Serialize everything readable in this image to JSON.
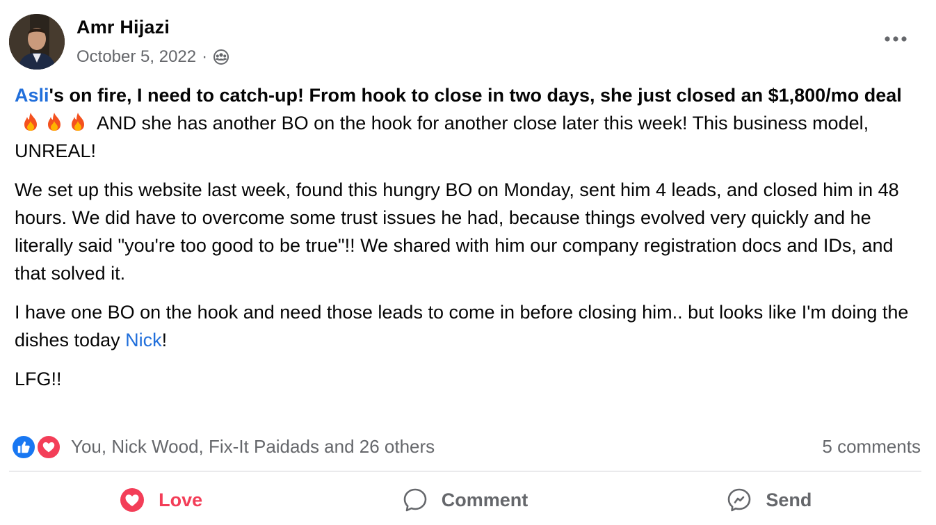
{
  "post": {
    "author": "Amr Hijazi",
    "date": "October 5, 2022",
    "separator": "·",
    "audience_icon": "group-icon",
    "more_icon": "more-options-icon"
  },
  "content": {
    "p1_mention": "Asli",
    "p1_bold": "'s on fire, I need to catch-up! From hook to close in two days, she just closed an $1,800/mo deal",
    "p1_rest": " AND she has another BO on the hook for another close later this week! This business model, UNREAL!",
    "p2": "We set up this website last week, found this hungry BO on Monday, sent him 4 leads, and closed him in 48 hours. We did have to overcome some trust issues he had, because things evolved very quickly and he literally said \"you're too good to be true\"!! We shared with him our company registration docs and IDs, and that solved it.",
    "p3_before": "I have one BO on the hook and need those leads to come in before closing him.. but looks like I'm doing the dishes today ",
    "p3_mention": "Nick",
    "p3_after": "!",
    "p4": "LFG!!"
  },
  "reactions": {
    "icons": [
      "like-icon",
      "love-icon"
    ],
    "summary": "You, Nick Wood, Fix-It Paidads and 26 others",
    "comments": "5 comments"
  },
  "actions": [
    {
      "label": "Love",
      "icon": "heart-icon"
    },
    {
      "label": "Comment",
      "icon": "comment-icon"
    },
    {
      "label": "Send",
      "icon": "messenger-icon"
    }
  ],
  "colors": {
    "mention": "#216fdb",
    "secondary_text": "#65676b",
    "love": "#f33e58",
    "like": "#1877f2",
    "divider": "#ced0d4"
  }
}
